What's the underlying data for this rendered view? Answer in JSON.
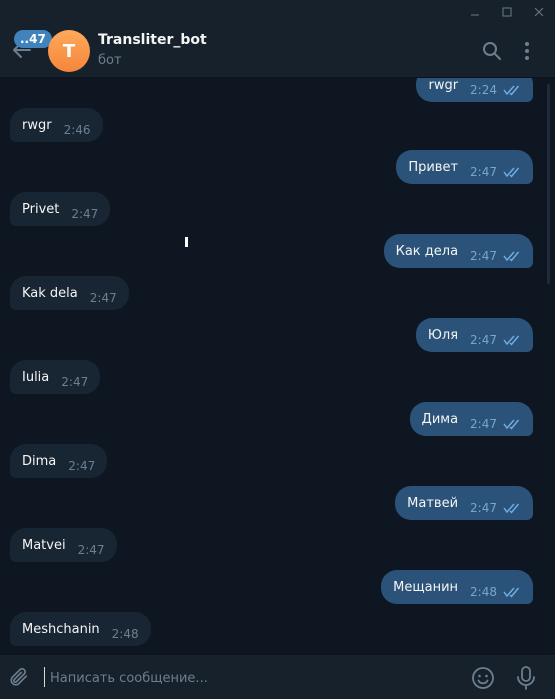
{
  "header": {
    "unread_count": "..47",
    "avatar_letter": "T",
    "title": "Transliter_bot",
    "status": "бот"
  },
  "messages": [
    {
      "dir": "out",
      "text": "rwgr",
      "time": "2:24"
    },
    {
      "dir": "in",
      "text": "rwgr",
      "time": "2:46"
    },
    {
      "dir": "out",
      "text": "Привет",
      "time": "2:47"
    },
    {
      "dir": "in",
      "text": "Privet",
      "time": "2:47"
    },
    {
      "dir": "out",
      "text": "Как дела",
      "time": "2:47"
    },
    {
      "dir": "in",
      "text": "Kak dela",
      "time": "2:47"
    },
    {
      "dir": "out",
      "text": "Юля",
      "time": "2:47"
    },
    {
      "dir": "in",
      "text": "Iulia",
      "time": "2:47"
    },
    {
      "dir": "out",
      "text": "Дима",
      "time": "2:47"
    },
    {
      "dir": "in",
      "text": "Dima",
      "time": "2:47"
    },
    {
      "dir": "out",
      "text": "Матвей",
      "time": "2:47"
    },
    {
      "dir": "in",
      "text": "Matvei",
      "time": "2:47"
    },
    {
      "dir": "out",
      "text": "Мещанин",
      "time": "2:48"
    },
    {
      "dir": "in",
      "text": "Meshchanin",
      "time": "2:48"
    }
  ],
  "composer": {
    "placeholder": "Написать сообщение..."
  },
  "colors": {
    "background": "#0e1621",
    "panel": "#17212b",
    "incoming_bubble": "#182533",
    "outgoing_bubble": "#2b5278",
    "accent": "#4082bc"
  },
  "icons": [
    "minimize-icon",
    "maximize-icon",
    "close-icon",
    "back-arrow-icon",
    "search-icon",
    "more-vertical-icon",
    "paperclip-icon",
    "emoji-icon",
    "microphone-icon",
    "double-check-icon"
  ]
}
